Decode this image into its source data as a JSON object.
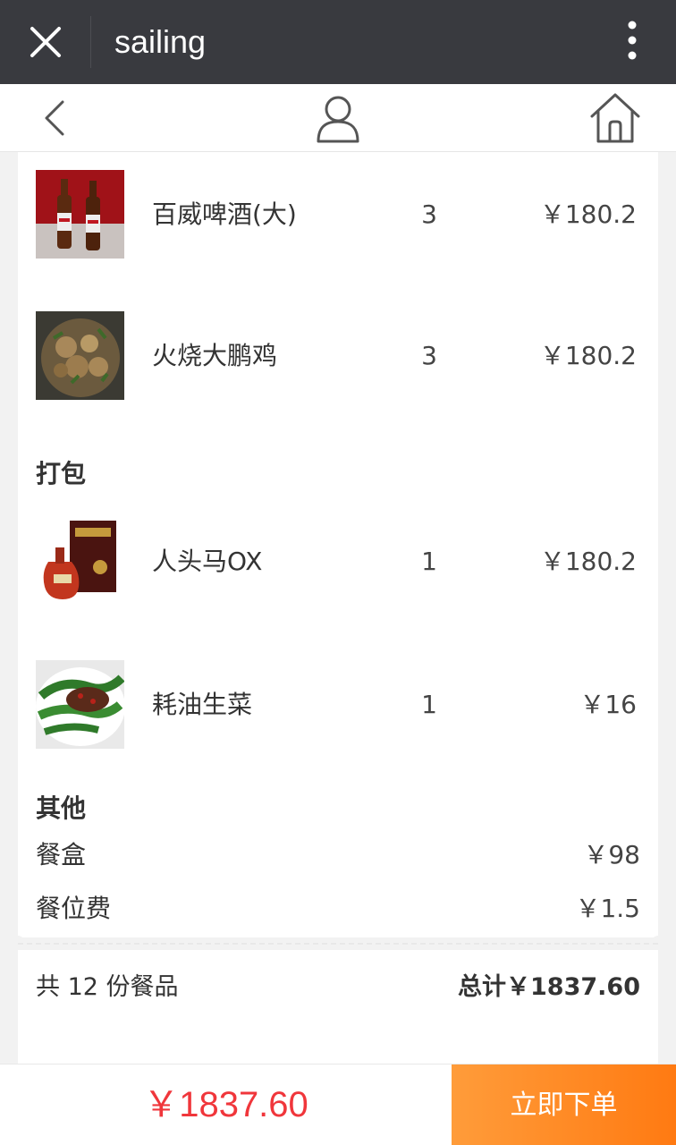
{
  "window": {
    "title": "sailing"
  },
  "icons": {
    "close": "close-icon",
    "more": "more-vertical-icon",
    "back": "chevron-left-icon",
    "user": "user-icon",
    "home": "home-icon"
  },
  "items_dine_in": [
    {
      "name": "百威啤酒(大)",
      "qty": "3",
      "price": "￥180.2",
      "thumb": "beer-bottles"
    },
    {
      "name": "火烧大鹏鸡",
      "qty": "3",
      "price": "￥180.2",
      "thumb": "chicken-dish"
    }
  ],
  "takeout": {
    "title": "打包",
    "items": [
      {
        "name": "人头马OX",
        "qty": "1",
        "price": "￥180.2",
        "thumb": "cognac-box"
      },
      {
        "name": "耗油生菜",
        "qty": "1",
        "price": "￥16",
        "thumb": "green-vegetable"
      }
    ]
  },
  "other": {
    "title": "其他",
    "fees": [
      {
        "label": "餐盒",
        "value": "￥98"
      },
      {
        "label": "餐位费",
        "value": "￥1.5"
      }
    ]
  },
  "summary": {
    "count_text": "共 12 份餐品",
    "total_text": "总计￥1837.60"
  },
  "footer": {
    "amount": "￥1837.60",
    "order_button": "立即下单"
  },
  "colors": {
    "topbar": "#393a3f",
    "price_red": "#f0363b",
    "order_orange": "#ff8a1f"
  }
}
